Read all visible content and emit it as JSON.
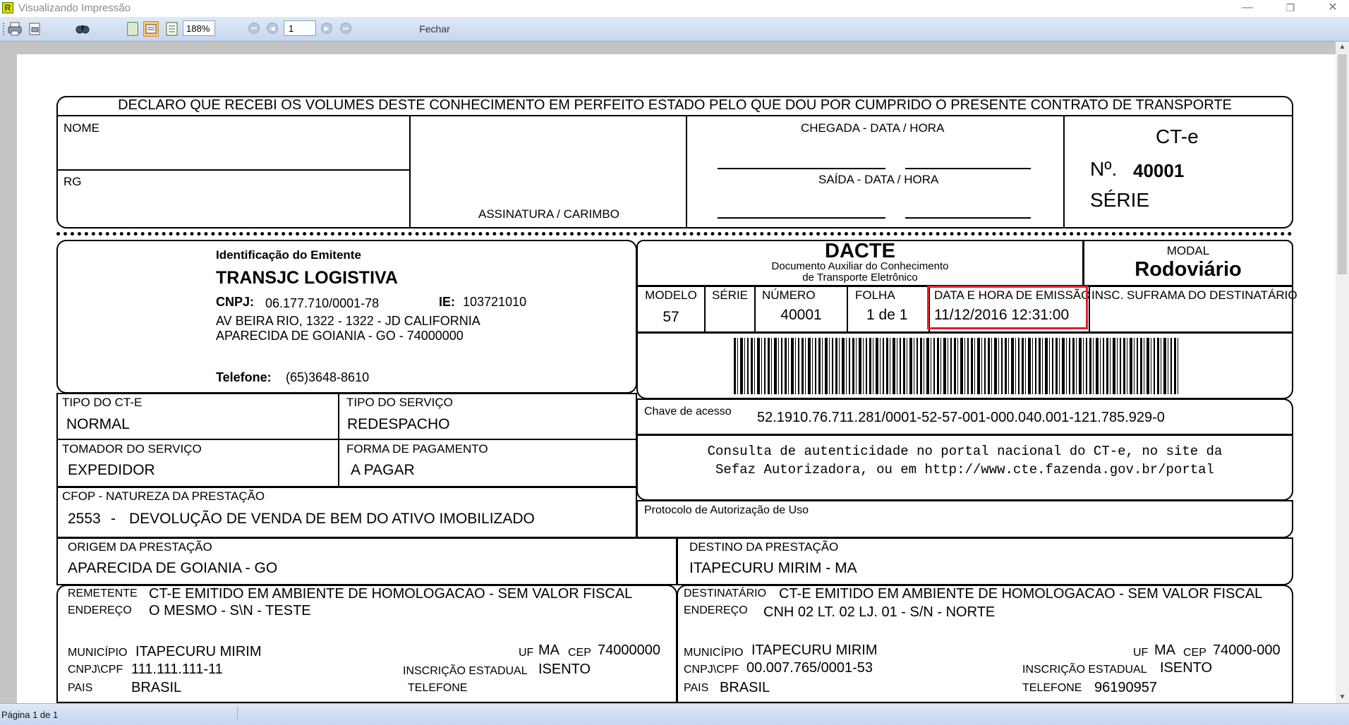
{
  "window": {
    "title": "Visualizando Impressão",
    "app_icon_letter": "R",
    "minimize": "—",
    "restore": "❐",
    "close": "✕"
  },
  "toolbar": {
    "icons": [
      "print-icon",
      "print-setup-icon",
      "find-icon",
      "single-page-icon",
      "two-page-icon",
      "multi-page-icon"
    ],
    "zoom": "188%",
    "page_input": "1",
    "close_label": "Fechar",
    "nav": [
      "⏮",
      "◀",
      "▶",
      "⏭"
    ]
  },
  "status": {
    "page_info": "Página 1 de 1"
  },
  "colors": {
    "highlight": "#e0202a",
    "toolbar": "#d4e1f4"
  },
  "doc": {
    "receipt": {
      "declaration": "DECLARO QUE RECEBI OS VOLUMES DESTE CONHECIMENTO EM PERFEITO ESTADO PELO QUE DOU POR CUMPRIDO O PRESENTE CONTRATO DE TRANSPORTE",
      "nome": "NOME",
      "rg": "RG",
      "assinatura": "ASSINATURA / CARIMBO",
      "chegada": "CHEGADA - DATA / HORA",
      "saida": "SAÍDA - DATA / HORA",
      "cte": "CT-e",
      "numero_label": "Nº.",
      "numero": "40001",
      "serie": "SÉRIE"
    },
    "emitente": {
      "heading": "Identificação do Emitente",
      "name": "TRANSJC LOGISTIVA",
      "cnpj_label": "CNPJ:",
      "cnpj": "06.177.710/0001-78",
      "ie_label": "IE:",
      "ie": "103721010",
      "address1": "AV BEIRA RIO, 1322 - 1322 - JD CALIFORNIA",
      "address2": "APARECIDA DE GOIANIA - GO - 74000000",
      "phone_label": "Telefone:",
      "phone": "(65)3648-8610"
    },
    "dacte": {
      "title": "DACTE",
      "sub1": "Documento Auxiliar do Conhecimento",
      "sub2": "de Transporte Eletrônico",
      "modal_label": "MODAL",
      "modal": "Rodoviário"
    },
    "info": {
      "modelo_label": "MODELO",
      "modelo": "57",
      "serie_label": "SÉRIE",
      "serie": "",
      "numero_label": "NÚMERO",
      "numero": "40001",
      "folha_label": "FOLHA",
      "folha": "1 de 1",
      "emissao_label": "DATA E HORA DE EMISSÃO",
      "emissao": "11/12/2016 12:31:00",
      "suframa_label": "INSC. SUFRAMA DO DESTINATÁRIO"
    },
    "chave": {
      "label": "Chave de acesso",
      "value": "52.1910.76.711.281/0001-52-57-001-000.040.001-121.785.929-0"
    },
    "consulta": {
      "line1": "Consulta de autenticidade no portal nacional do CT-e, no site da",
      "line2": "Sefaz Autorizadora, ou em http://www.cte.fazenda.gov.br/portal"
    },
    "protocolo": {
      "label": "Protocolo de Autorização de Uso"
    },
    "tipo_cte": {
      "label": "TIPO DO CT-E",
      "value": "NORMAL"
    },
    "tipo_servico": {
      "label": "TIPO DO SERVIÇO",
      "value": "REDESPACHO"
    },
    "tomador": {
      "label": "TOMADOR DO SERVIÇO",
      "value": "EXPEDIDOR"
    },
    "pagamento": {
      "label": "FORMA DE PAGAMENTO",
      "value": "A PAGAR"
    },
    "cfop": {
      "label": "CFOP - NATUREZA DA PRESTAÇÃO",
      "code": "2553",
      "dash": "-",
      "value": "DEVOLUÇÃO DE VENDA DE BEM DO ATIVO IMOBILIZADO"
    },
    "origem": {
      "label": "ORIGEM DA PRESTAÇÃO",
      "value": "APARECIDA DE GOIANIA - GO"
    },
    "destino": {
      "label": "DESTINO DA PRESTAÇÃO",
      "value": "ITAPECURU MIRIM - MA"
    },
    "remetente": {
      "label": "REMETENTE",
      "name": "CT-E EMITIDO EM AMBIENTE DE HOMOLOGACAO - SEM VALOR FISCAL",
      "end_label": "ENDEREÇO",
      "endereco": "O MESMO - S\\N - TESTE",
      "mun_label": "MUNICÍPIO",
      "municipio": "ITAPECURU MIRIM",
      "uf_label": "UF",
      "uf": "MA",
      "cep_label": "CEP",
      "cep": "74000000",
      "cnpj_label": "CNPJ\\CPF",
      "cnpj": "111.111.111-11",
      "ie_label": "INSCRIÇÃO ESTADUAL",
      "ie": "ISENTO",
      "pais_label": "PAIS",
      "pais": "BRASIL",
      "tel_label": "TELEFONE",
      "telefone": ""
    },
    "destinatario": {
      "label": "DESTINATÁRIO",
      "name": "CT-E EMITIDO EM AMBIENTE DE HOMOLOGACAO - SEM VALOR FISCAL",
      "end_label": "ENDEREÇO",
      "endereco": "CNH 02 LT. 02 LJ. 01 - S/N - NORTE",
      "mun_label": "MUNICÍPIO",
      "municipio": "ITAPECURU MIRIM",
      "uf_label": "UF",
      "uf": "MA",
      "cep_label": "CEP",
      "cep": "74000-000",
      "cnpj_label": "CNPJ\\CPF",
      "cnpj": "00.007.765/0001-53",
      "ie_label": "INSCRIÇÃO ESTADUAL",
      "ie": "ISENTO",
      "pais_label": "PAIS",
      "pais": "BRASIL",
      "tel_label": "TELEFONE",
      "telefone": "96190957"
    }
  }
}
